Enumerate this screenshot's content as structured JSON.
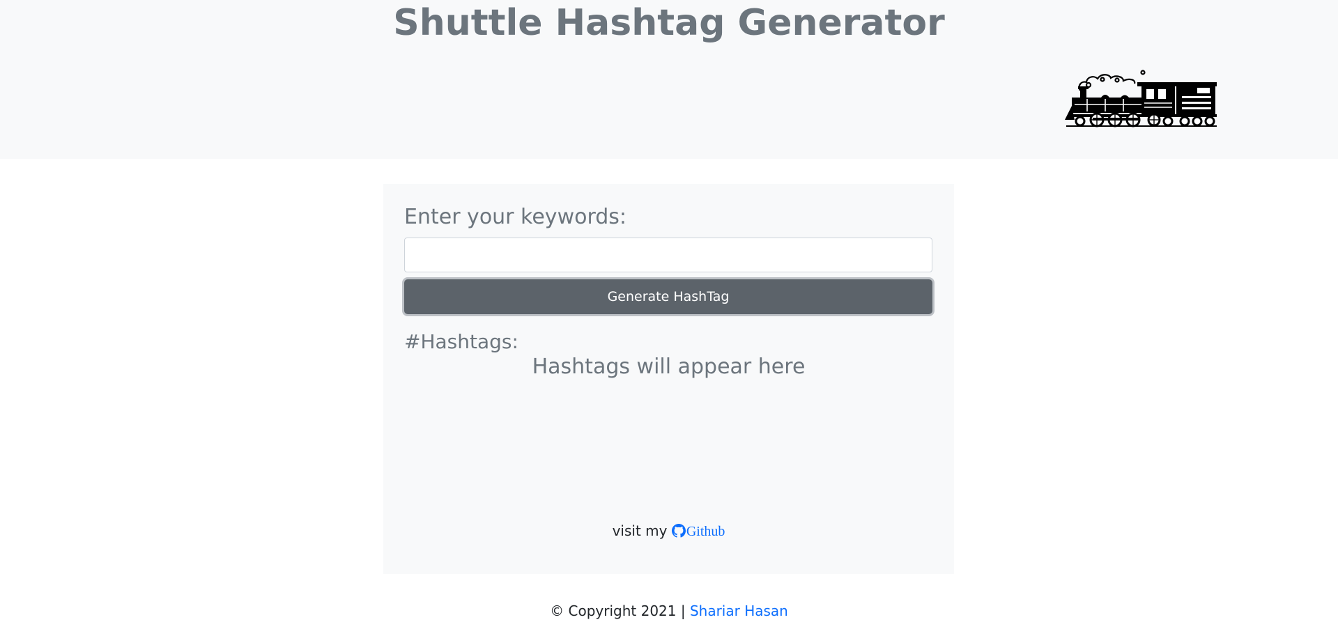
{
  "header": {
    "title": "Shuttle Hashtag Generator",
    "logo_icon": "steam-locomotive-icon"
  },
  "form": {
    "keywords_label": "Enter your keywords:",
    "keywords_value": "",
    "keywords_placeholder": "",
    "generate_button_label": "Generate HashTag"
  },
  "results": {
    "label": "#Hashtags:",
    "placeholder_text": "Hashtags will appear here"
  },
  "github": {
    "prefix": "visit my",
    "icon": "github-icon",
    "link_label": "Github"
  },
  "footer": {
    "copyright": "© Copyright 2021 |",
    "author_link": "Shariar Hasan"
  },
  "colors": {
    "header_bg": "#f8f9fa",
    "title": "#6c757d",
    "button_bg": "#5c636a",
    "link": "#0d6efd"
  }
}
